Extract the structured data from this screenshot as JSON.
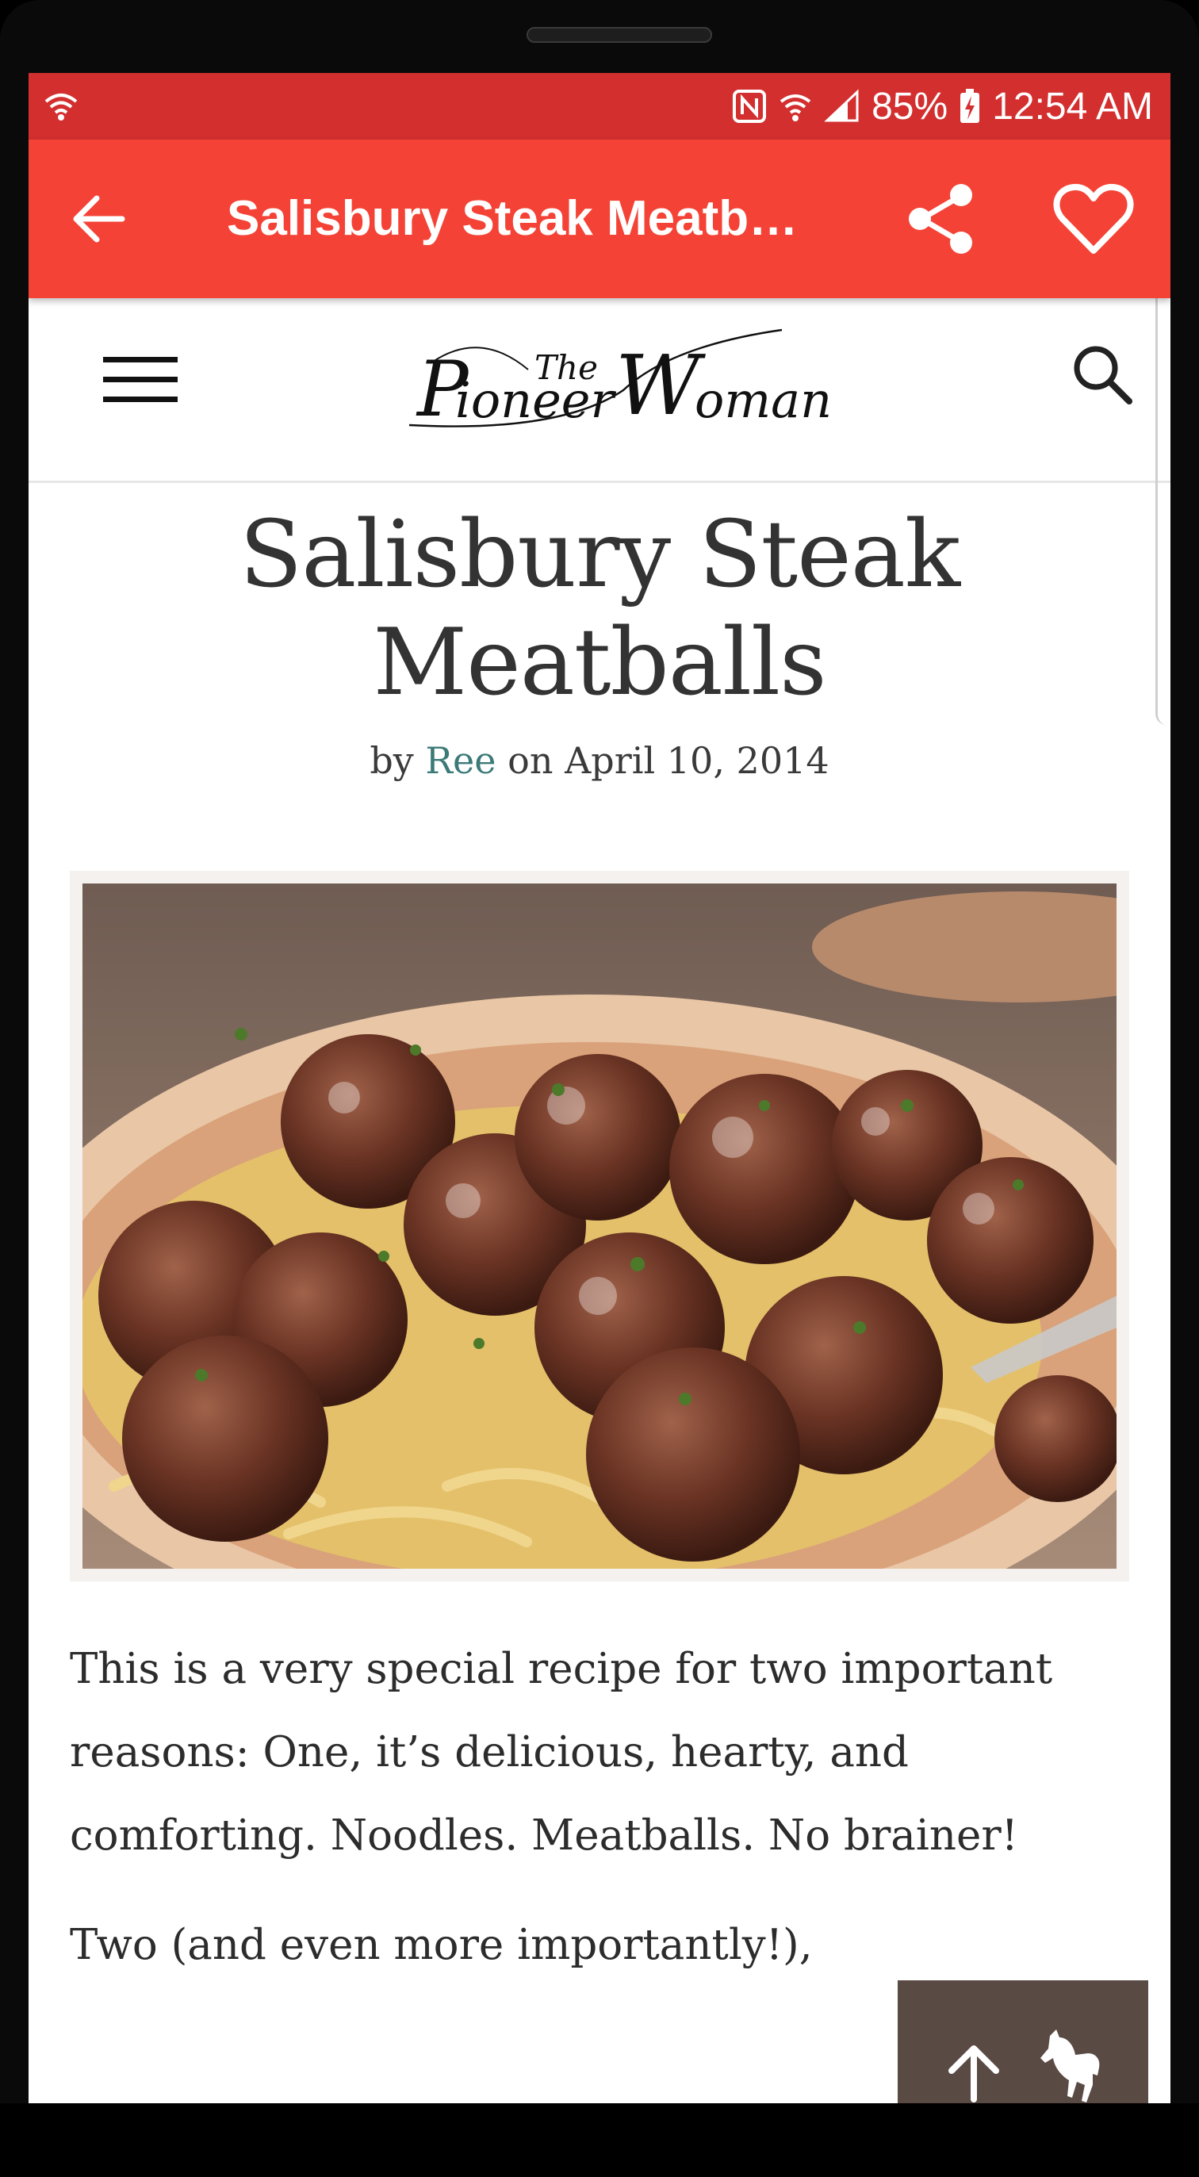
{
  "status_bar": {
    "battery": "85%",
    "time": "12:54 AM"
  },
  "app_bar": {
    "title": "Salisbury Steak Meatb…",
    "icons": [
      "back-arrow-icon",
      "share-icon",
      "heart-icon"
    ]
  },
  "site_header": {
    "logo_text": "The Pioneer Woman",
    "icons": [
      "hamburger-menu-icon",
      "search-icon"
    ]
  },
  "article": {
    "title": "Salisbury Steak Meatballs",
    "byline_prefix": "by",
    "author": "Ree",
    "byline_date": "on April 10, 2014",
    "paragraph_1": "This is a very special recipe for two important reasons: One, it’s delicious, hearty, and comforting. Noodles. Meatballs. No brainer!",
    "paragraph_2_partial": "Two (and even more importantly!),"
  },
  "fab": {
    "icons": [
      "arrow-up-icon",
      "horse-icon"
    ]
  },
  "colors": {
    "status_bar": "#d32f2f",
    "app_bar": "#f44336",
    "link": "#3b7a77",
    "fab": "#5a4a44"
  }
}
